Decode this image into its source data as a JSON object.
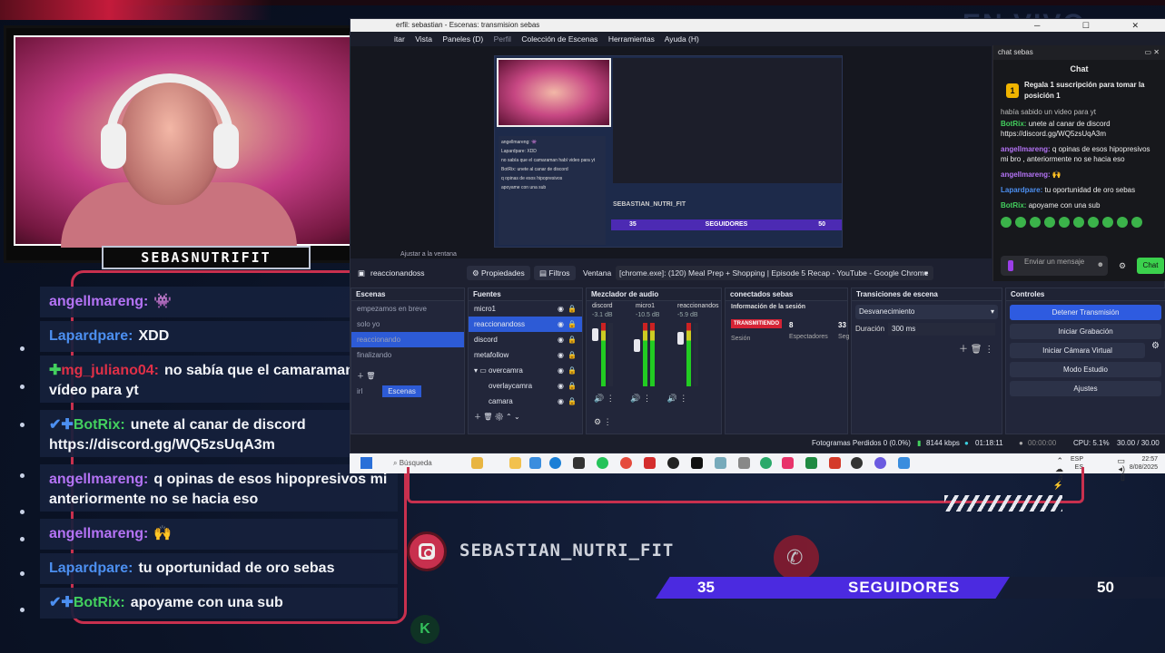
{
  "webcam": {
    "nameplate": "SEBASNUTRIFIT"
  },
  "overlay_chat": [
    {
      "user": "angellmareng:",
      "user_color": "#b473f5",
      "text": "👾",
      "icon": ""
    },
    {
      "user": "Lapardpare:",
      "user_color": "#4c8ff0",
      "text": "XDD",
      "icon": ""
    },
    {
      "user": "mg_juliano04:",
      "user_color": "#e03047",
      "text": "no sabía que el camaraman habí vídeo para yt",
      "icon": "✚"
    },
    {
      "user": "BotRix:",
      "user_color": "#43d05e",
      "text": "unete al canar de discord https://discord.gg/WQ5zsUqA3m",
      "icon": "✔✚"
    },
    {
      "user": "angellmareng:",
      "user_color": "#b473f5",
      "text": "q opinas de esos hipopresivos mi anteriormente no se hacia eso",
      "icon": ""
    },
    {
      "user": "angellmareng:",
      "user_color": "#b473f5",
      "text": "🙌",
      "icon": ""
    },
    {
      "user": "Lapardpare:",
      "user_color": "#4c8ff0",
      "text": "tu oportunidad de oro sebas",
      "icon": ""
    },
    {
      "user": "BotRix:",
      "user_color": "#43d05e",
      "text": "apoyame con una sub",
      "icon": "✔✚"
    }
  ],
  "obs": {
    "title": "erfil: sebastian - Escenas: transmision sebas",
    "menu": [
      "itar",
      "Vista",
      "Paneles (D)",
      "Perfil",
      "Colección de Escenas",
      "Herramientas",
      "Ayuda (H)"
    ],
    "status_adjust": "Ajustar a la ventana",
    "source_name": "reaccionandoss",
    "properties_btn": "Propiedades",
    "filters_btn": "Filtros",
    "window_label": "Ventana",
    "window_value": "[chrome.exe]: (120) Meal Prep + Shopping | Episode 5 Recap - YouTube - Google Chrome",
    "scenes_header": "Escenas",
    "scenes": [
      "empezamos en breve",
      "solo yo",
      "reaccionando",
      "finalizando",
      "irl"
    ],
    "scenes_tab": "Escenas",
    "sources_header": "Fuentes",
    "sources": [
      "micro1",
      "reaccionandoss",
      "discord",
      "metafollow",
      "overcamra",
      "overlaycamra",
      "camara"
    ],
    "mixer_header": "Mezclador de audio",
    "mixer": [
      {
        "name": "discord",
        "db": "-3.1 dB"
      },
      {
        "name": "micro1",
        "db": "-10.5 dB"
      },
      {
        "name": "reaccionandos",
        "db": "-5.9 dB"
      }
    ],
    "connected_header": "conectados sebas",
    "session_info": "Información de la sesión",
    "streaming_badge": "TRANSMITIENDO",
    "session_label": "Sesión",
    "viewers_count": "8",
    "viewers_label": "Espectadores",
    "extra_count": "33",
    "extra_label": "Seg",
    "transitions_header": "Transiciones de escena",
    "transition_value": "Desvanecimiento",
    "duration_label": "Duración",
    "duration_value": "300 ms",
    "controls_header": "Controles",
    "controls": [
      "Detener Transmisión",
      "Iniciar Grabación",
      "Iniciar Cámara Virtual",
      "Modo Estudio",
      "Ajustes"
    ],
    "status": {
      "dropped": "Fotogramas Perdidos 0 (0.0%)",
      "bitrate": "8144 kbps",
      "live_time": "01:18:11",
      "rec_time": "00:00:00",
      "cpu": "CPU: 5.1%",
      "fps": "30.00 / 30.00 FPS"
    },
    "preview": {
      "mini_name": "SEBASTIAN_NUTRI_FIT",
      "mini_count1": "35",
      "mini_label": "SEGUIDORES",
      "mini_count2": "50",
      "mini_chat": [
        "angellmareng: 👾",
        "Lapardpare: XDD",
        "no sabía que el camaraman habí video para yt",
        "BotRix: unete al canar de discord",
        "q opinas de esos hipopresivos",
        "apoyame con una sub"
      ]
    }
  },
  "taskbar": {
    "search": "Búsqueda",
    "lang": "ESP",
    "lang2": "ES",
    "time": "22:57",
    "date": "8/08/2025"
  },
  "chat_panel": {
    "header": "chat sebas",
    "title": "Chat",
    "promo_badge": "1",
    "promo": "Regala 1 suscripción para tomar la posición 1",
    "clipped": "había sabido un video para yt",
    "messages": [
      {
        "user": "BotRix:",
        "cls": "g",
        "text": "unete al canar de discord https://discord.gg/WQ5zsUqA3m"
      },
      {
        "user": "angellmareng:",
        "cls": "p",
        "text": "q opinas de esos hipopresivos mi bro , anteriormente no se hacia eso"
      },
      {
        "user": "angellmareng:",
        "cls": "p",
        "text": "🙌"
      },
      {
        "user": "Lapardpare:",
        "cls": "bl",
        "text": "tu oportunidad de oro sebas"
      },
      {
        "user": "BotRix:",
        "cls": "g",
        "text": "apoyame con una sub"
      }
    ],
    "input_placeholder": "Enviar un mensaje",
    "send_label": "Chat"
  },
  "bottom_overlay": {
    "handle": "SEBASTIAN_NUTRI_FIT",
    "count_current": "35",
    "label": "SEGUIDORES",
    "count_goal": "50",
    "logo": "K"
  }
}
